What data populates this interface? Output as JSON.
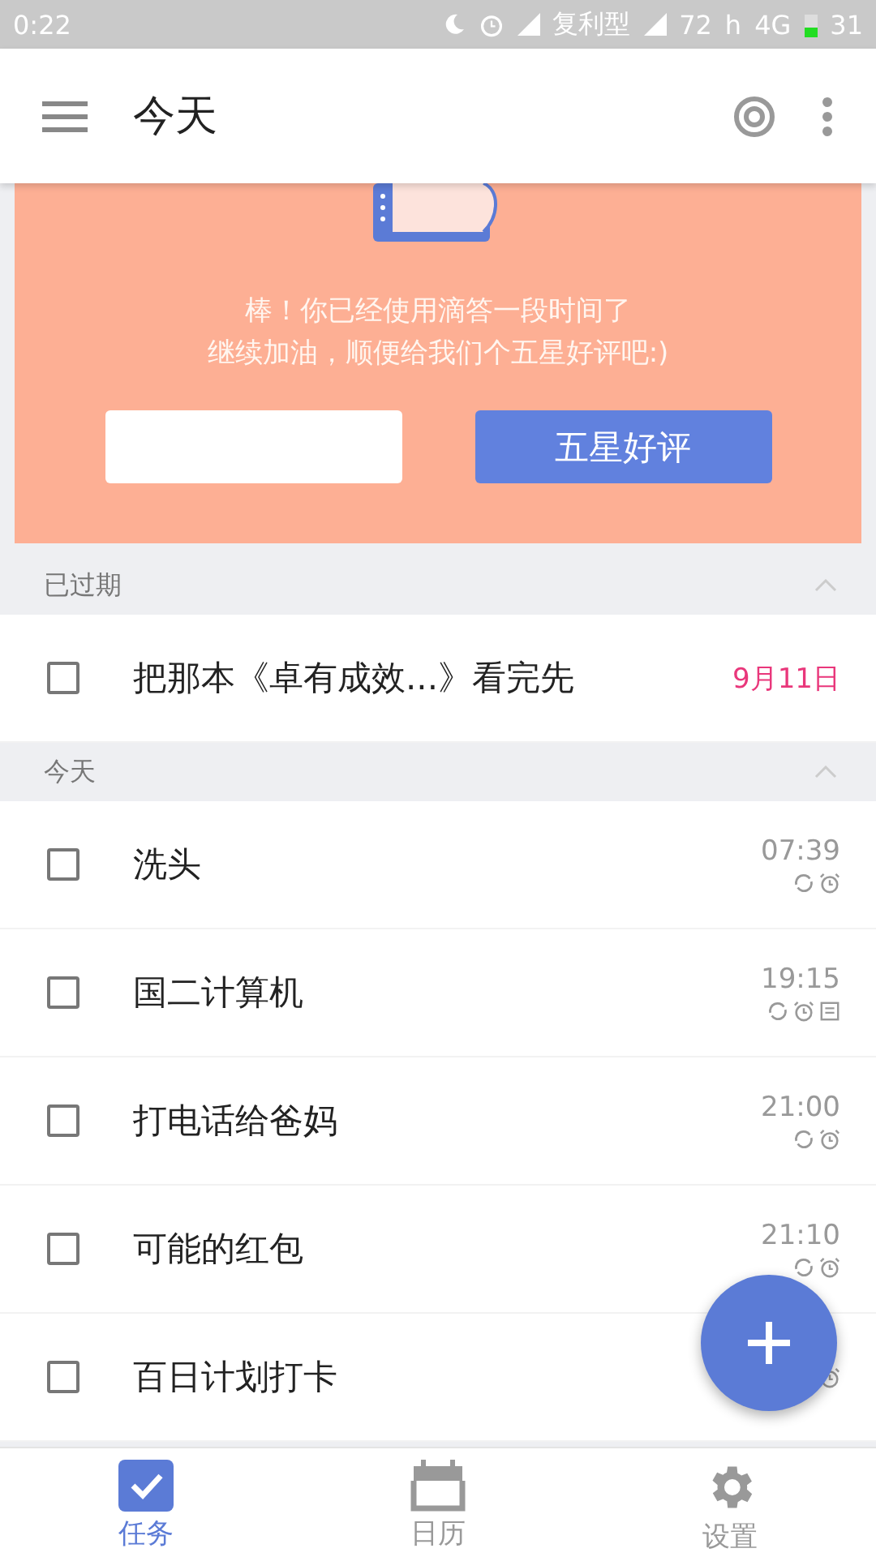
{
  "status_bar": {
    "time": "0:22",
    "carrier": "复利型",
    "speed": "72",
    "network_h": "h",
    "network": "4G",
    "battery": "31"
  },
  "toolbar": {
    "title": "今天"
  },
  "banner": {
    "lines": [
      "棒！你已经使用滴答一段时间了",
      "继续加油，顺便给我们个五星好评吧:)"
    ],
    "button": "五星好评"
  },
  "sections": [
    {
      "title": "已过期",
      "expanded": true,
      "tasks": [
        {
          "title": "把那本《卓有成效...》看完先",
          "checked": false,
          "date": "9月11日",
          "overdue": true,
          "repeat": false,
          "alarm": false,
          "note": false
        }
      ]
    },
    {
      "title": "今天",
      "expanded": true,
      "tasks": [
        {
          "title": "洗头",
          "checked": false,
          "date": "07:39",
          "overdue": false,
          "repeat": true,
          "alarm": true,
          "note": false
        },
        {
          "title": "国二计算机",
          "checked": false,
          "date": "19:15",
          "overdue": false,
          "repeat": true,
          "alarm": true,
          "note": true
        },
        {
          "title": "打电话给爸妈",
          "checked": false,
          "date": "21:00",
          "overdue": false,
          "repeat": true,
          "alarm": true,
          "note": false
        },
        {
          "title": "可能的红包",
          "checked": false,
          "date": "21:10",
          "overdue": false,
          "repeat": true,
          "alarm": true,
          "note": false
        },
        {
          "title": "百日计划打卡",
          "checked": false,
          "repeat": false,
          "alarm": true,
          "note": false
        }
      ]
    }
  ],
  "bottom_nav": [
    {
      "label": "任务",
      "kind": "tasks",
      "selected": true
    },
    {
      "label": "日历",
      "kind": "calendar",
      "selected": false
    },
    {
      "label": "设置",
      "kind": "settings",
      "selected": false
    }
  ]
}
